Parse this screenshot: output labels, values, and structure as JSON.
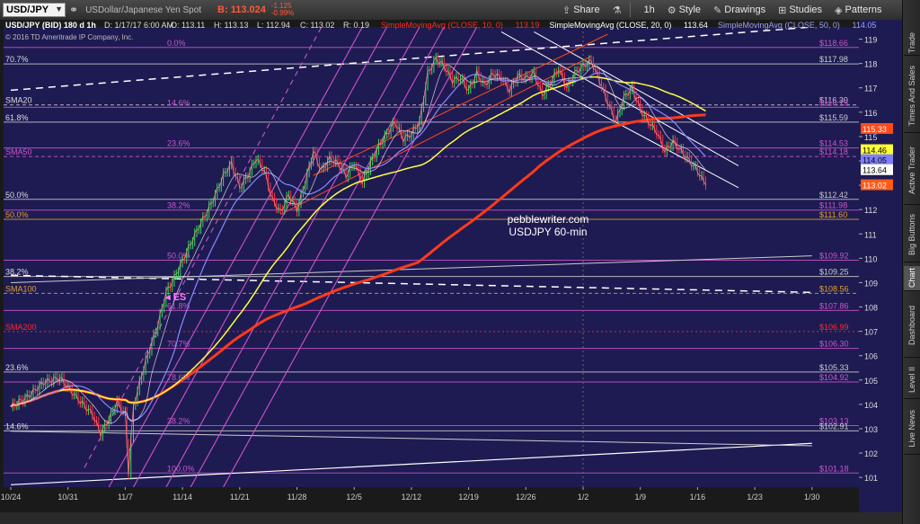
{
  "toolbar": {
    "symbol": "USD/JPY",
    "description": "USDollar/Japanese Yen Spot",
    "price": "B: 113.024",
    "change_top": "-1.125",
    "change_bottom": "-0.99%",
    "share_label": "Share",
    "timeframe": "1h",
    "style_label": "Style",
    "drawings_label": "Drawings",
    "studies_label": "Studies",
    "patterns_label": "Patterns"
  },
  "sidebar": {
    "tabs": [
      "Trade",
      "Times And Sales",
      "Active Trader",
      "Big Buttons",
      "Chart",
      "Dashboard",
      "Level II",
      "Live News"
    ],
    "active": "Chart"
  },
  "chart_data": {
    "type": "line",
    "header": {
      "title": "USD/JPY (BID) 180 d 1h",
      "date": "D: 1/17/17 6:00 AM",
      "open": "O: 113.11",
      "high": "H: 113.13",
      "low": "L: 112.94",
      "close": "C: 113.02",
      "range": "R: 0.19",
      "copyright": "© 2016 TD Ameritrade IP Company, Inc.",
      "studies": [
        {
          "label": "SimpleMovingAvg (CLOSE, 10, 0)",
          "value": "113.19",
          "color": "#ff2a2a"
        },
        {
          "label": "SimpleMovingAvg (CLOSE, 20, 0)",
          "value": "113.64",
          "color": "#ffffff"
        },
        {
          "label": "SimpleMovingAvg (CLOSE, 50, 0)",
          "value": "114.05",
          "color": "#9aa0ff"
        }
      ]
    },
    "annotation": [
      "pebblewriter.com",
      "USDJPY 60-min"
    ],
    "es_label": "◂ ES",
    "x_labels": [
      "10/24",
      "10/31",
      "11/7",
      "11/14",
      "11/21",
      "11/28",
      "12/5",
      "12/12",
      "12/19",
      "12/26",
      "1/2",
      "1/9",
      "1/16",
      "1/23",
      "1/30"
    ],
    "x_label_days": [
      0,
      7,
      14,
      21,
      28,
      35,
      42,
      49,
      56,
      63,
      70,
      77,
      84,
      91,
      98
    ],
    "ylim": [
      100.6,
      119.5
    ],
    "y_ticks": [
      101,
      102,
      103,
      104,
      105,
      106,
      107,
      108,
      109,
      110,
      111,
      112,
      113,
      114,
      115,
      116,
      117,
      118,
      119
    ],
    "close": [
      [
        0,
        103.9
      ],
      [
        2,
        104.3
      ],
      [
        4,
        104.9
      ],
      [
        6,
        105.1
      ],
      [
        8,
        104.3
      ],
      [
        10,
        103.6
      ],
      [
        11,
        102.8
      ],
      [
        12,
        103.4
      ],
      [
        13,
        104.1
      ],
      [
        14,
        103.6
      ],
      [
        14.4,
        101.2
      ],
      [
        15,
        103.9
      ],
      [
        16,
        105.2
      ],
      [
        17,
        106.3
      ],
      [
        18,
        107.3
      ],
      [
        19,
        108.6
      ],
      [
        20,
        109.2
      ],
      [
        21,
        109.9
      ],
      [
        22,
        110.6
      ],
      [
        23,
        111.3
      ],
      [
        24,
        111.9
      ],
      [
        25,
        112.6
      ],
      [
        26,
        113.4
      ],
      [
        27,
        113.9
      ],
      [
        28,
        112.9
      ],
      [
        29,
        113.4
      ],
      [
        30,
        114.1
      ],
      [
        31,
        113.6
      ],
      [
        32,
        112.4
      ],
      [
        33,
        111.9
      ],
      [
        34,
        112.6
      ],
      [
        35,
        112.0
      ],
      [
        36,
        113.1
      ],
      [
        37,
        114.4
      ],
      [
        38,
        113.6
      ],
      [
        39,
        114.1
      ],
      [
        40,
        113.9
      ],
      [
        41,
        113.4
      ],
      [
        42,
        113.9
      ],
      [
        43,
        113.1
      ],
      [
        44,
        113.9
      ],
      [
        45,
        114.6
      ],
      [
        46,
        115.1
      ],
      [
        47,
        115.6
      ],
      [
        48,
        114.9
      ],
      [
        49,
        115.1
      ],
      [
        50,
        115.6
      ],
      [
        51,
        117.6
      ],
      [
        52,
        118.2
      ],
      [
        53,
        117.9
      ],
      [
        54,
        117.3
      ],
      [
        55,
        117.4
      ],
      [
        56,
        116.9
      ],
      [
        57,
        117.6
      ],
      [
        58,
        117.1
      ],
      [
        59,
        117.6
      ],
      [
        60,
        117.4
      ],
      [
        61,
        116.9
      ],
      [
        62,
        117.5
      ],
      [
        63,
        117.4
      ],
      [
        64,
        117.6
      ],
      [
        65,
        116.7
      ],
      [
        66,
        117.2
      ],
      [
        67,
        117.8
      ],
      [
        68,
        117.0
      ],
      [
        69,
        117.6
      ],
      [
        70,
        117.9
      ],
      [
        71,
        118.1
      ],
      [
        72,
        117.3
      ],
      [
        73,
        116.4
      ],
      [
        74,
        115.6
      ],
      [
        75,
        116.6
      ],
      [
        76,
        117.0
      ],
      [
        77,
        116.1
      ],
      [
        78,
        115.6
      ],
      [
        79,
        115.2
      ],
      [
        80,
        114.4
      ],
      [
        81,
        114.8
      ],
      [
        82,
        114.4
      ],
      [
        83,
        114.0
      ],
      [
        84,
        113.6
      ],
      [
        85,
        113.0
      ]
    ],
    "levels": [
      {
        "value": 118.66,
        "label": "$118.66",
        "color": "#cc55cc",
        "style": "solid",
        "left": "0.0%"
      },
      {
        "value": 117.98,
        "label": "$117.98",
        "color": "#cccccc",
        "style": "solid",
        "left": "70.7%"
      },
      {
        "value": 116.3,
        "label": "$116.30",
        "color": "#cccccc",
        "style": "dashed",
        "left": "SMA20"
      },
      {
        "value": 116.2,
        "label": "$116.19",
        "color": "#cc55cc",
        "style": "solid",
        "left": "14.6%"
      },
      {
        "value": 115.59,
        "label": "$115.59",
        "color": "#cccccc",
        "style": "solid",
        "left": "61.8%"
      },
      {
        "value": 114.53,
        "label": "$114.53",
        "color": "#cc55cc",
        "style": "solid",
        "left": "23.6%"
      },
      {
        "value": 114.18,
        "label": "$114.18",
        "color": "#cc55cc",
        "style": "dashed",
        "left": "SMA50"
      },
      {
        "value": 112.42,
        "label": "$112.42",
        "color": "#cccccc",
        "style": "solid",
        "left": "50.0%"
      },
      {
        "value": 111.98,
        "label": "$111.98",
        "color": "#cc55cc",
        "style": "solid",
        "left": "38.2%"
      },
      {
        "value": 111.6,
        "label": "$111.60",
        "color": "#e0a030",
        "style": "solid",
        "left": "50.0%"
      },
      {
        "value": 109.92,
        "label": "$109.92",
        "color": "#cc55cc",
        "style": "solid",
        "left": "50.0%"
      },
      {
        "value": 109.25,
        "label": "$109.25",
        "color": "#cccccc",
        "style": "solid",
        "left": "38.2%"
      },
      {
        "value": 108.56,
        "label": "$108.56",
        "color": "#e0a030",
        "style": "dashed",
        "left": "SMA100"
      },
      {
        "value": 107.86,
        "label": "$107.86",
        "color": "#cc55cc",
        "style": "solid",
        "left": "61.8%"
      },
      {
        "value": 106.99,
        "label": "$106.99",
        "color": "#ff2a2a",
        "style": "dotted",
        "left": "SMA200"
      },
      {
        "value": 106.3,
        "label": "$106.30",
        "color": "#cc55cc",
        "style": "solid",
        "left": "70.7%"
      },
      {
        "value": 105.33,
        "label": "$105.33",
        "color": "#cccccc",
        "style": "solid",
        "left": "23.6%"
      },
      {
        "value": 104.92,
        "label": "$104.92",
        "color": "#cc55cc",
        "style": "solid",
        "left": "78.6%"
      },
      {
        "value": 103.13,
        "label": "$103.13",
        "color": "#cc55cc",
        "style": "solid",
        "left": "38.2%"
      },
      {
        "value": 102.91,
        "label": "$102.91",
        "color": "#cccccc",
        "style": "solid",
        "left": "14.6%"
      },
      {
        "value": 101.18,
        "label": "$101.18",
        "color": "#cc55cc",
        "style": "solid",
        "left": "100.0%"
      }
    ],
    "price_tags": [
      {
        "value": 115.33,
        "label": "115.33",
        "bg": "#ff4a1a",
        "fg": "#ffffff"
      },
      {
        "value": 114.46,
        "label": "114.46",
        "bg": "#ffff33",
        "fg": "#000000"
      },
      {
        "value": 114.05,
        "label": "114.05",
        "bg": "#8080ff",
        "fg": "#000000"
      },
      {
        "value": 113.64,
        "label": "113.64",
        "bg": "#ffffff",
        "fg": "#000000"
      },
      {
        "value": 113.02,
        "label": "113.02",
        "bg": "#ff5a1a",
        "fg": "#ffffff"
      }
    ],
    "trendlines": [
      {
        "color": "#ffffff",
        "dash": "8,6",
        "width": 1.5,
        "p1": [
          0,
          116.9
        ],
        "p2": [
          98,
          119.5
        ]
      },
      {
        "color": "#ffffff",
        "dash": "",
        "width": 1.2,
        "p1": [
          0,
          100.7
        ],
        "p2": [
          98,
          102.4
        ]
      },
      {
        "color": "#cccccc",
        "dash": "",
        "width": 1,
        "p1": [
          0,
          102.9
        ],
        "p2": [
          98,
          102.3
        ]
      },
      {
        "color": "#ffffff",
        "dash": "8,6",
        "width": 1.5,
        "p1": [
          0,
          109.3
        ],
        "p2": [
          98,
          108.6
        ]
      },
      {
        "color": "#cccccc",
        "dash": "",
        "width": 1,
        "p1": [
          0,
          109.0
        ],
        "p2": [
          98,
          110.1
        ]
      },
      {
        "color": "#ffffff",
        "dash": "",
        "width": 1,
        "p1": [
          64,
          119.3
        ],
        "p2": [
          89,
          114.6
        ]
      },
      {
        "color": "#ffffff",
        "dash": "",
        "width": 1,
        "p1": [
          60,
          119.3
        ],
        "p2": [
          89,
          113.8
        ]
      },
      {
        "color": "#ffffff",
        "dash": "",
        "width": 1,
        "p1": [
          65,
          117.2
        ],
        "p2": [
          89,
          112.9
        ]
      },
      {
        "color": "#ff4a1a",
        "dash": "",
        "width": 1,
        "p1": [
          33,
          111.8
        ],
        "p2": [
          71,
          118.3
        ]
      },
      {
        "color": "#ff4a1a",
        "dash": "",
        "width": 1,
        "p1": [
          37,
          113.4
        ],
        "p2": [
          73,
          119.2
        ]
      },
      {
        "color": "#cc55cc",
        "dash": "",
        "width": 1.1,
        "p1": [
          12,
          100.6
        ],
        "p2": [
          43,
          119.5
        ]
      },
      {
        "color": "#cc55cc",
        "dash": "",
        "width": 1.1,
        "p1": [
          15,
          100.6
        ],
        "p2": [
          46,
          119.5
        ]
      },
      {
        "color": "#cc55cc",
        "dash": "6,5",
        "width": 1.1,
        "p1": [
          9,
          101.4
        ],
        "p2": [
          38,
          119.5
        ]
      },
      {
        "color": "#cc55cc",
        "dash": "",
        "width": 1.1,
        "p1": [
          19,
          100.6
        ],
        "p2": [
          50,
          119.5
        ]
      },
      {
        "color": "#cc55cc",
        "dash": "",
        "width": 1.1,
        "p1": [
          22,
          100.6
        ],
        "p2": [
          53,
          119.5
        ]
      },
      {
        "color": "#cc55cc",
        "dash": "",
        "width": 1.1,
        "p1": [
          26,
          100.6
        ],
        "p2": [
          57,
          119.5
        ]
      }
    ],
    "grid": false,
    "legend": "top-left"
  }
}
